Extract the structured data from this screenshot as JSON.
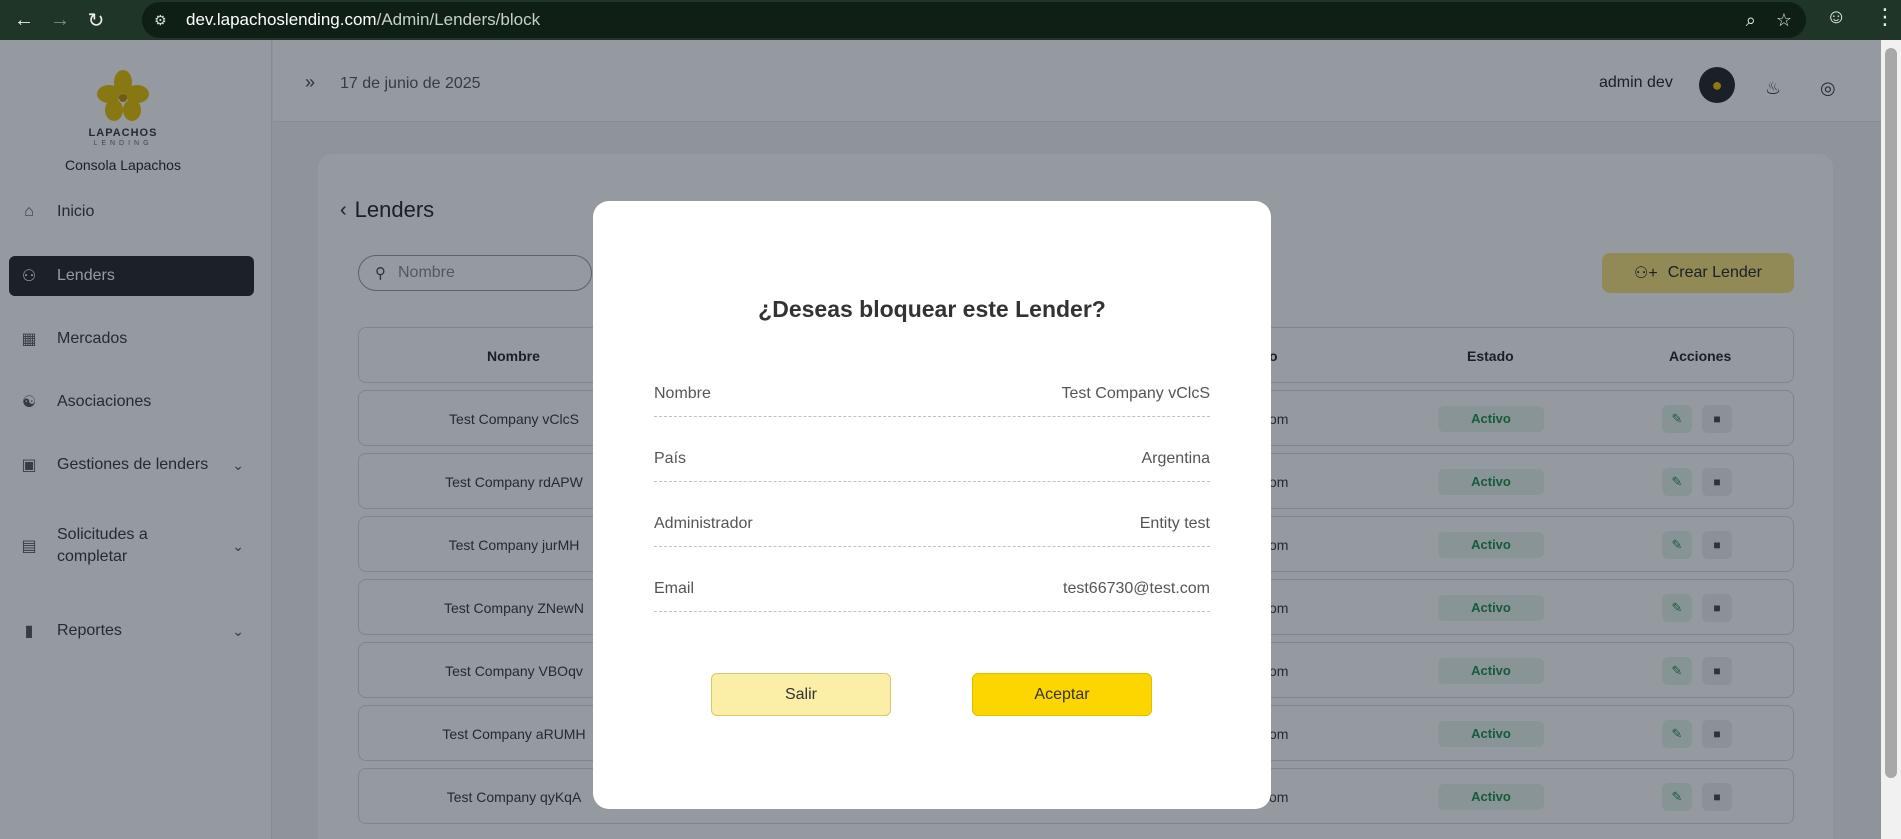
{
  "browser": {
    "url_host": "dev.lapachoslending.com",
    "url_path": "/Admin/Lenders/block"
  },
  "sidebar": {
    "logo_text": "LAPACHOS",
    "logo_sub": "LENDING",
    "console_name": "Consola Lapachos",
    "items": [
      {
        "label": "Inicio",
        "icon": "home-icon"
      },
      {
        "label": "Lenders",
        "icon": "users-icon",
        "active": true
      },
      {
        "label": "Mercados",
        "icon": "store-icon"
      },
      {
        "label": "Asociaciones",
        "icon": "handshake-icon"
      },
      {
        "label": "Gestiones de lenders",
        "icon": "briefcase-icon"
      },
      {
        "label_line1": "Solicitudes a",
        "label_line2": "completar",
        "icon": "file-icon"
      },
      {
        "label": "Reportes",
        "icon": "bar-chart-icon"
      }
    ]
  },
  "header": {
    "date": "17 de junio de 2025",
    "user_name": "admin dev"
  },
  "page": {
    "title": "Lenders",
    "search_placeholder": "Nombre",
    "create_button": "Crear Lender",
    "columns": {
      "nombre": "Nombre",
      "partial": "o",
      "estado": "Estado",
      "acciones": "Acciones"
    },
    "rows": [
      {
        "name": "Test Company vClcS",
        "partial": "om",
        "estado": "Activo"
      },
      {
        "name": "Test Company rdAPW",
        "partial": "om",
        "estado": "Activo"
      },
      {
        "name": "Test Company jurMH",
        "partial": "om",
        "estado": "Activo"
      },
      {
        "name": "Test Company ZNewN",
        "partial": "om",
        "estado": "Activo"
      },
      {
        "name": "Test Company VBOqv",
        "partial": "om",
        "estado": "Activo"
      },
      {
        "name": "Test Company aRUMH",
        "partial": "om",
        "estado": "Activo"
      },
      {
        "name": "Test Company qyKqA",
        "partial": "om",
        "estado": "Activo"
      }
    ]
  },
  "modal": {
    "title": "¿Deseas bloquear este Lender?",
    "fields": [
      {
        "label": "Nombre",
        "value": "Test Company vClcS"
      },
      {
        "label": "País",
        "value": "Argentina"
      },
      {
        "label": "Administrador",
        "value": "Entity test"
      },
      {
        "label": "Email",
        "value": "test66730@test.com"
      }
    ],
    "cancel_label": "Salir",
    "confirm_label": "Aceptar"
  },
  "colors": {
    "accent_yellow": "#fdd600",
    "active_green": "#1d8b4a",
    "sidebar_active": "#232323"
  }
}
